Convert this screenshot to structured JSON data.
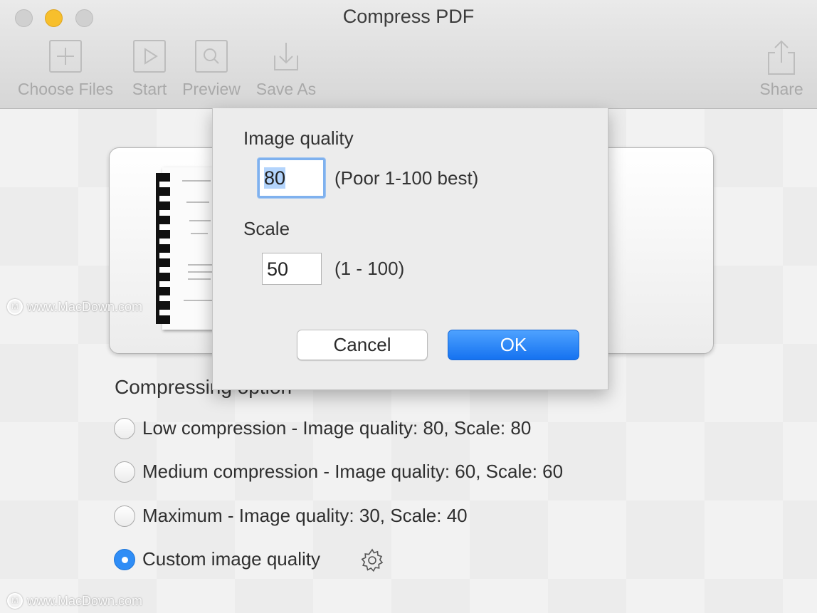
{
  "window": {
    "title": "Compress PDF"
  },
  "toolbar": {
    "choose_files": "Choose Files",
    "start": "Start",
    "preview": "Preview",
    "save_as": "Save As",
    "share": "Share"
  },
  "compressing": {
    "section_title": "Compressing option",
    "options": [
      {
        "label": "Low compression - Image quality: 80, Scale: 80",
        "selected": false
      },
      {
        "label": "Medium compression - Image quality: 60, Scale: 60",
        "selected": false
      },
      {
        "label": "Maximum - Image quality: 30, Scale: 40",
        "selected": false
      },
      {
        "label": "Custom image quality",
        "selected": true
      }
    ]
  },
  "dialog": {
    "image_quality_label": "Image quality",
    "image_quality_value": "80",
    "image_quality_hint": "(Poor 1-100 best)",
    "scale_label": "Scale",
    "scale_value": "50",
    "scale_hint": "(1 - 100)",
    "cancel_label": "Cancel",
    "ok_label": "OK"
  },
  "watermark": {
    "text": "www.MacDown.com"
  },
  "colors": {
    "accent": "#2f8df6",
    "minimize": "#f7bf2c"
  },
  "icons": [
    "plus-icon",
    "play-icon",
    "magnifier-icon",
    "download-icon",
    "share-icon",
    "gear-icon",
    "document-icon"
  ]
}
